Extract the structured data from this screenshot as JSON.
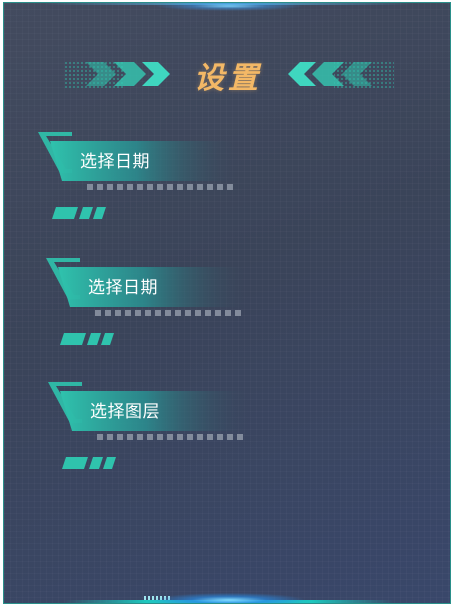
{
  "panel": {
    "title": "设置"
  },
  "settings": [
    {
      "label": "选择日期",
      "icon": "date-tag"
    },
    {
      "label": "选择日期",
      "icon": "date-tag"
    },
    {
      "label": "选择图层",
      "icon": "layer-tag"
    }
  ],
  "colors": {
    "panel_bg": "#3a4459",
    "accent_teal": "#2fc3ad",
    "title_gold": "#f3b866",
    "border": "#2a8f8a"
  }
}
